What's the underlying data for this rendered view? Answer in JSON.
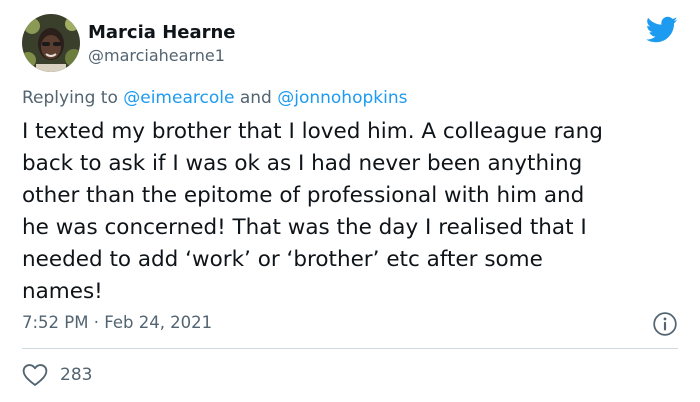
{
  "tweet": {
    "author_name": "Marcia Hearne",
    "author_handle": "@marciahearne1",
    "reply_prefix": "Replying to ",
    "reply_user_1": "@eimearcole",
    "reply_joiner": " and ",
    "reply_user_2": "@jonnohopkins",
    "body": "I texted my brother that I loved him. A colleague rang\nback to ask if I was ok as I had never been anything\nother than the epitome of professional with him and\nhe was concerned! That was the day I realised that I\nneeded to add ‘work’ or ‘brother’ etc after some\nnames!",
    "time": "7:52 PM",
    "separator": " · ",
    "date": "Feb 24, 2021",
    "like_count": "283"
  },
  "icons": {
    "logo": "twitter-bird-icon",
    "info": "info-icon",
    "like": "heart-icon"
  },
  "colors": {
    "brand": "#1d9bf0",
    "text": "#0f1419",
    "secondary": "#536471",
    "divider": "#cfd9de"
  }
}
